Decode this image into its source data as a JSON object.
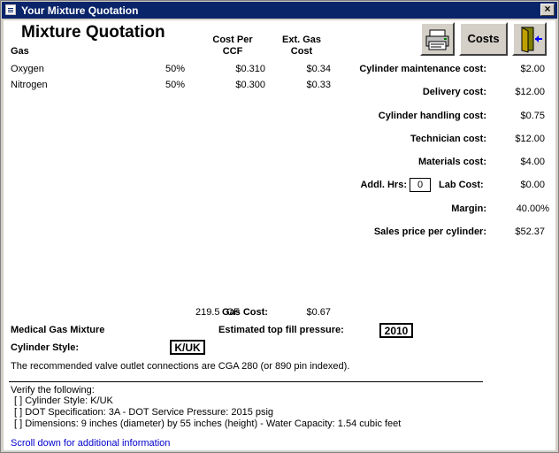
{
  "window": {
    "title": "Your Mixture Quotation",
    "close_label": "×"
  },
  "header": {
    "title": "Mixture Quotation",
    "col_gas": "Gas",
    "col_cost_per_l1": "Cost Per",
    "col_cost_per_l2": "CCF",
    "col_ext_l1": "Ext. Gas",
    "col_ext_l2": "Cost"
  },
  "toolbar": {
    "costs_label": "Costs"
  },
  "gases": [
    {
      "name": "Oxygen",
      "percent": "50%",
      "cost_per": "$0.310",
      "ext_cost": "$0.34"
    },
    {
      "name": "Nitrogen",
      "percent": "50%",
      "cost_per": "$0.300",
      "ext_cost": "$0.33"
    }
  ],
  "costs": {
    "maintenance_label": "Cylinder maintenance cost:",
    "maintenance_value": "$2.00",
    "delivery_label": "Delivery cost:",
    "delivery_value": "$12.00",
    "handling_label": "Cylinder handling cost:",
    "handling_value": "$0.75",
    "technician_label": "Technician cost:",
    "technician_value": "$12.00",
    "materials_label": "Materials cost:",
    "materials_value": "$4.00",
    "addl_hrs_label": "Addl. Hrs:",
    "addl_hrs_value": "0",
    "lab_label": "Lab Cost:",
    "lab_value": "$0.00",
    "margin_label": "Margin:",
    "margin_value": "40.00%",
    "sales_label": "Sales price per cylinder:",
    "sales_value": "$52.37"
  },
  "summary": {
    "volume": "219.5",
    "volume_unit": "CF",
    "gas_cost_label": "Gas Cost:",
    "gas_cost_value": "$0.67",
    "mixture_type": "Medical Gas Mixture",
    "fill_pressure_label": "Estimated top fill pressure:",
    "fill_pressure_value": "2010",
    "cyl_style_label": "Cylinder Style:",
    "cyl_style_value": "K/UK",
    "valve_note": "The recommended valve outlet connections are CGA 280 (or 890 pin indexed)."
  },
  "verify": {
    "heading": "Verify the following:",
    "items": [
      "[  ] Cylinder Style: K/UK",
      "[  ] DOT Specification: 3A  -  DOT Service Pressure: 2015 psig",
      "[  ] Dimensions: 9 inches (diameter) by 55 inches (height)   -   Water Capacity: 1.54 cubic feet"
    ]
  },
  "footer": {
    "scroll_hint": "Scroll down for additional information"
  },
  "icons": {
    "print": "printer-icon",
    "exit": "exit-door-icon"
  }
}
